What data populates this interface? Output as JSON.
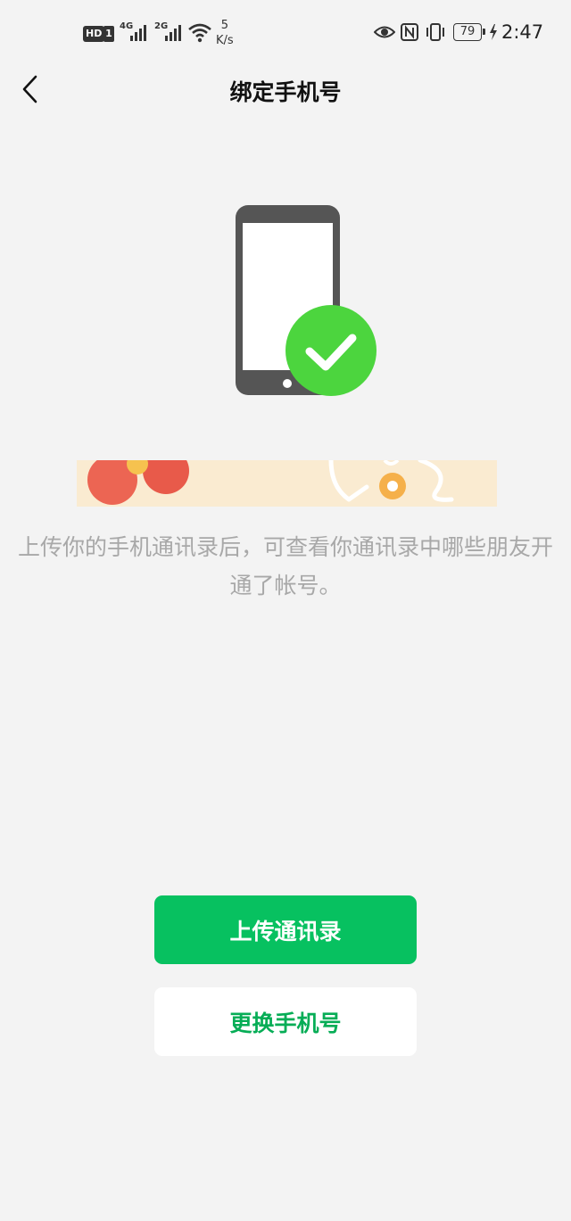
{
  "status_bar": {
    "hd": "HD",
    "sim": "1",
    "net1": "4G",
    "net2": "2G",
    "speed_value": "5",
    "speed_unit": "K/s",
    "battery": "79",
    "time": "2:47"
  },
  "header": {
    "title": "绑定手机号"
  },
  "main": {
    "description": "上传你的手机通讯录后，可查看你通讯录中哪些朋友开通了帐号。"
  },
  "actions": {
    "upload_label": "上传通讯录",
    "change_label": "更换手机号"
  },
  "colors": {
    "accent_green": "#07c160",
    "check_green": "#4cd53e",
    "secondary_text": "#06ad56",
    "background": "#f3f3f3"
  }
}
